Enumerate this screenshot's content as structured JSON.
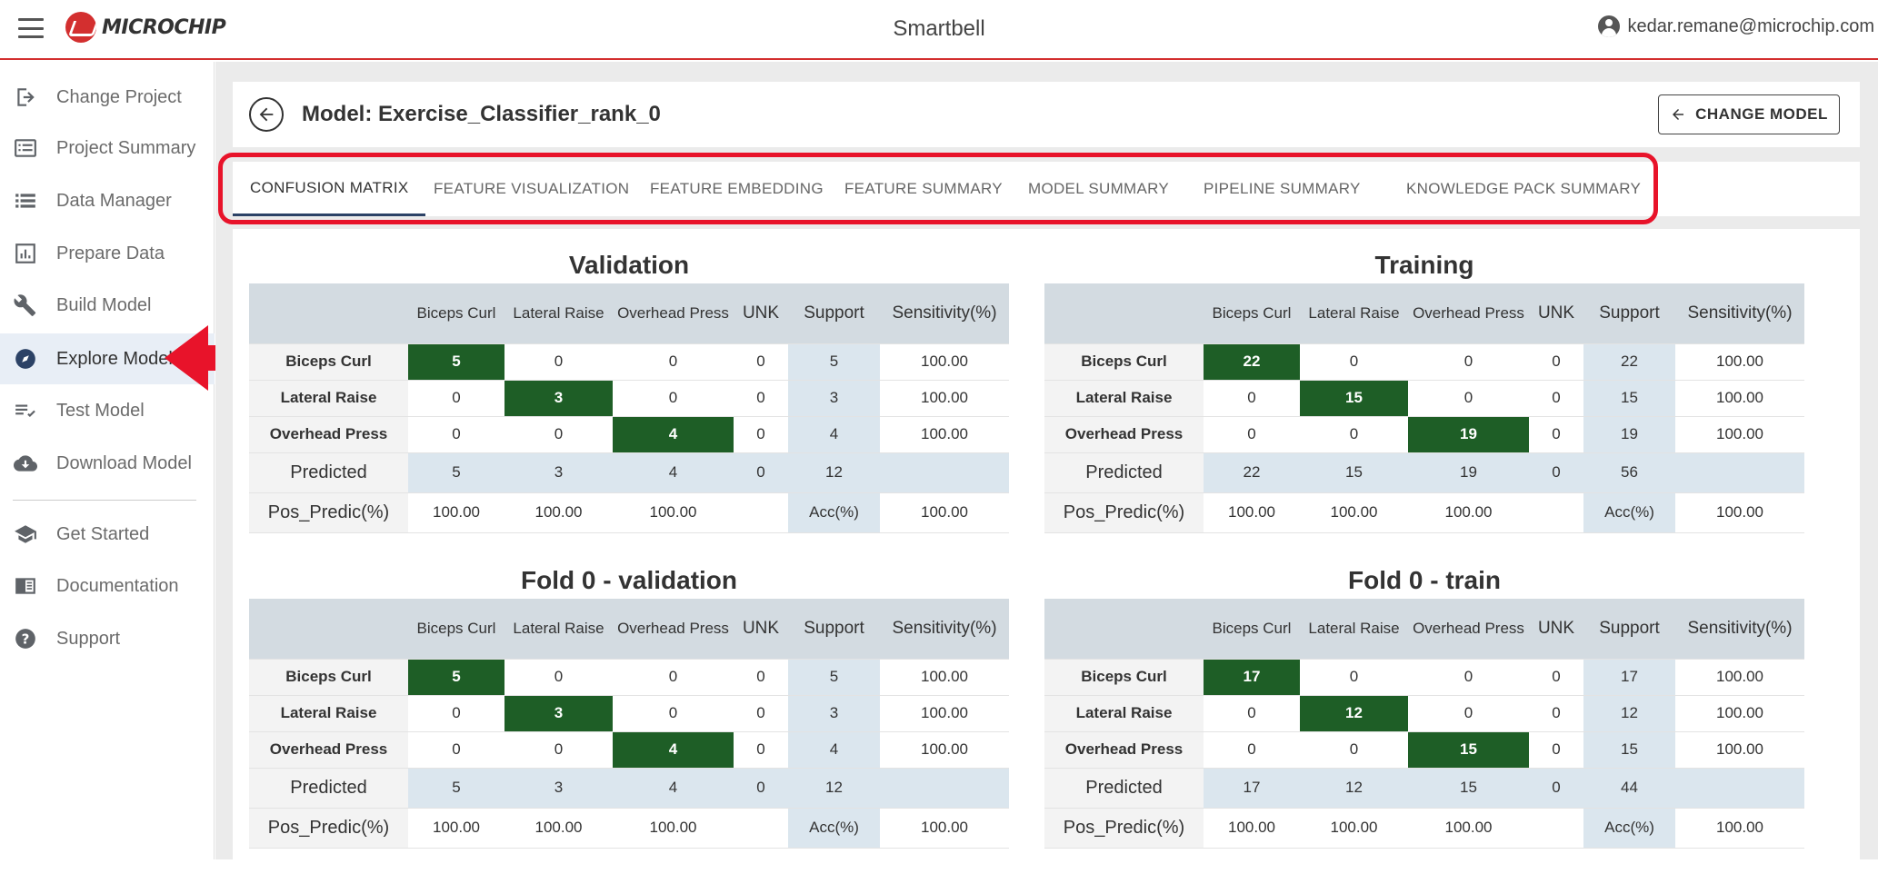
{
  "header": {
    "brand": "MICROCHIP",
    "app_title": "Smartbell",
    "user_email": "kedar.remane@microchip.com"
  },
  "sidebar": {
    "items": [
      {
        "label": "Change Project",
        "icon": "login-arrow-icon"
      },
      {
        "label": "Project Summary",
        "icon": "list-card-icon"
      },
      {
        "label": "Data Manager",
        "icon": "list-icon"
      },
      {
        "label": "Prepare Data",
        "icon": "chart-box-icon"
      },
      {
        "label": "Build Model",
        "icon": "wrench-icon"
      },
      {
        "label": "Explore Model",
        "icon": "compass-icon",
        "active": true
      },
      {
        "label": "Test Model",
        "icon": "checklist-icon"
      },
      {
        "label": "Download Model",
        "icon": "cloud-download-icon"
      },
      {
        "label": "Get Started",
        "icon": "school-icon"
      },
      {
        "label": "Documentation",
        "icon": "book-icon"
      },
      {
        "label": "Support",
        "icon": "help-circle-icon"
      }
    ]
  },
  "model": {
    "title": "Model: Exercise_Classifier_rank_0",
    "change_model_label": "CHANGE MODEL"
  },
  "tabs": [
    {
      "label": "CONFUSION MATRIX",
      "active": true
    },
    {
      "label": "FEATURE VISUALIZATION"
    },
    {
      "label": "FEATURE EMBEDDING"
    },
    {
      "label": "FEATURE SUMMARY"
    },
    {
      "label": "MODEL SUMMARY"
    },
    {
      "label": "PIPELINE SUMMARY"
    },
    {
      "label": "KNOWLEDGE PACK SUMMARY"
    }
  ],
  "matrices": [
    {
      "title": "Validation",
      "headers": [
        "",
        "Biceps Curl",
        "Lateral Raise",
        "Overhead Press",
        "UNK",
        "Support",
        "Sensitivity(%)"
      ],
      "rows": [
        {
          "label": "Biceps Curl",
          "cells": [
            "5",
            "0",
            "0",
            "0",
            "5",
            "100.00"
          ]
        },
        {
          "label": "Lateral Raise",
          "cells": [
            "0",
            "3",
            "0",
            "0",
            "3",
            "100.00"
          ]
        },
        {
          "label": "Overhead Press",
          "cells": [
            "0",
            "0",
            "4",
            "0",
            "4",
            "100.00"
          ]
        }
      ],
      "predicted": {
        "label": "Predicted",
        "cells": [
          "5",
          "3",
          "4",
          "0",
          "12",
          ""
        ]
      },
      "pos_predic": {
        "label": "Pos_Predic(%)",
        "cells": [
          "100.00",
          "100.00",
          "100.00",
          "",
          "Acc(%)",
          "100.00"
        ]
      }
    },
    {
      "title": "Training",
      "headers": [
        "",
        "Biceps Curl",
        "Lateral Raise",
        "Overhead Press",
        "UNK",
        "Support",
        "Sensitivity(%)"
      ],
      "rows": [
        {
          "label": "Biceps Curl",
          "cells": [
            "22",
            "0",
            "0",
            "0",
            "22",
            "100.00"
          ]
        },
        {
          "label": "Lateral Raise",
          "cells": [
            "0",
            "15",
            "0",
            "0",
            "15",
            "100.00"
          ]
        },
        {
          "label": "Overhead Press",
          "cells": [
            "0",
            "0",
            "19",
            "0",
            "19",
            "100.00"
          ]
        }
      ],
      "predicted": {
        "label": "Predicted",
        "cells": [
          "22",
          "15",
          "19",
          "0",
          "56",
          ""
        ]
      },
      "pos_predic": {
        "label": "Pos_Predic(%)",
        "cells": [
          "100.00",
          "100.00",
          "100.00",
          "",
          "Acc(%)",
          "100.00"
        ]
      }
    },
    {
      "title": "Fold 0 - validation",
      "headers": [
        "",
        "Biceps Curl",
        "Lateral Raise",
        "Overhead Press",
        "UNK",
        "Support",
        "Sensitivity(%)"
      ],
      "rows": [
        {
          "label": "Biceps Curl",
          "cells": [
            "5",
            "0",
            "0",
            "0",
            "5",
            "100.00"
          ]
        },
        {
          "label": "Lateral Raise",
          "cells": [
            "0",
            "3",
            "0",
            "0",
            "3",
            "100.00"
          ]
        },
        {
          "label": "Overhead Press",
          "cells": [
            "0",
            "0",
            "4",
            "0",
            "4",
            "100.00"
          ]
        }
      ],
      "predicted": {
        "label": "Predicted",
        "cells": [
          "5",
          "3",
          "4",
          "0",
          "12",
          ""
        ]
      },
      "pos_predic": {
        "label": "Pos_Predic(%)",
        "cells": [
          "100.00",
          "100.00",
          "100.00",
          "",
          "Acc(%)",
          "100.00"
        ]
      }
    },
    {
      "title": "Fold 0 - train",
      "headers": [
        "",
        "Biceps Curl",
        "Lateral Raise",
        "Overhead Press",
        "UNK",
        "Support",
        "Sensitivity(%)"
      ],
      "rows": [
        {
          "label": "Biceps Curl",
          "cells": [
            "17",
            "0",
            "0",
            "0",
            "17",
            "100.00"
          ]
        },
        {
          "label": "Lateral Raise",
          "cells": [
            "0",
            "12",
            "0",
            "0",
            "12",
            "100.00"
          ]
        },
        {
          "label": "Overhead Press",
          "cells": [
            "0",
            "0",
            "15",
            "0",
            "15",
            "100.00"
          ]
        }
      ],
      "predicted": {
        "label": "Predicted",
        "cells": [
          "17",
          "12",
          "15",
          "0",
          "44",
          ""
        ]
      },
      "pos_predic": {
        "label": "Pos_Predic(%)",
        "cells": [
          "100.00",
          "100.00",
          "100.00",
          "",
          "Acc(%)",
          "100.00"
        ]
      }
    }
  ],
  "colors": {
    "accent_red": "#d32f2f",
    "highlight_red": "#e8132a",
    "diag_green": "#1e5e26",
    "support_blue": "#dbe6ee",
    "header_grey": "#d3dbe1",
    "tab_underline": "#2c4266"
  }
}
